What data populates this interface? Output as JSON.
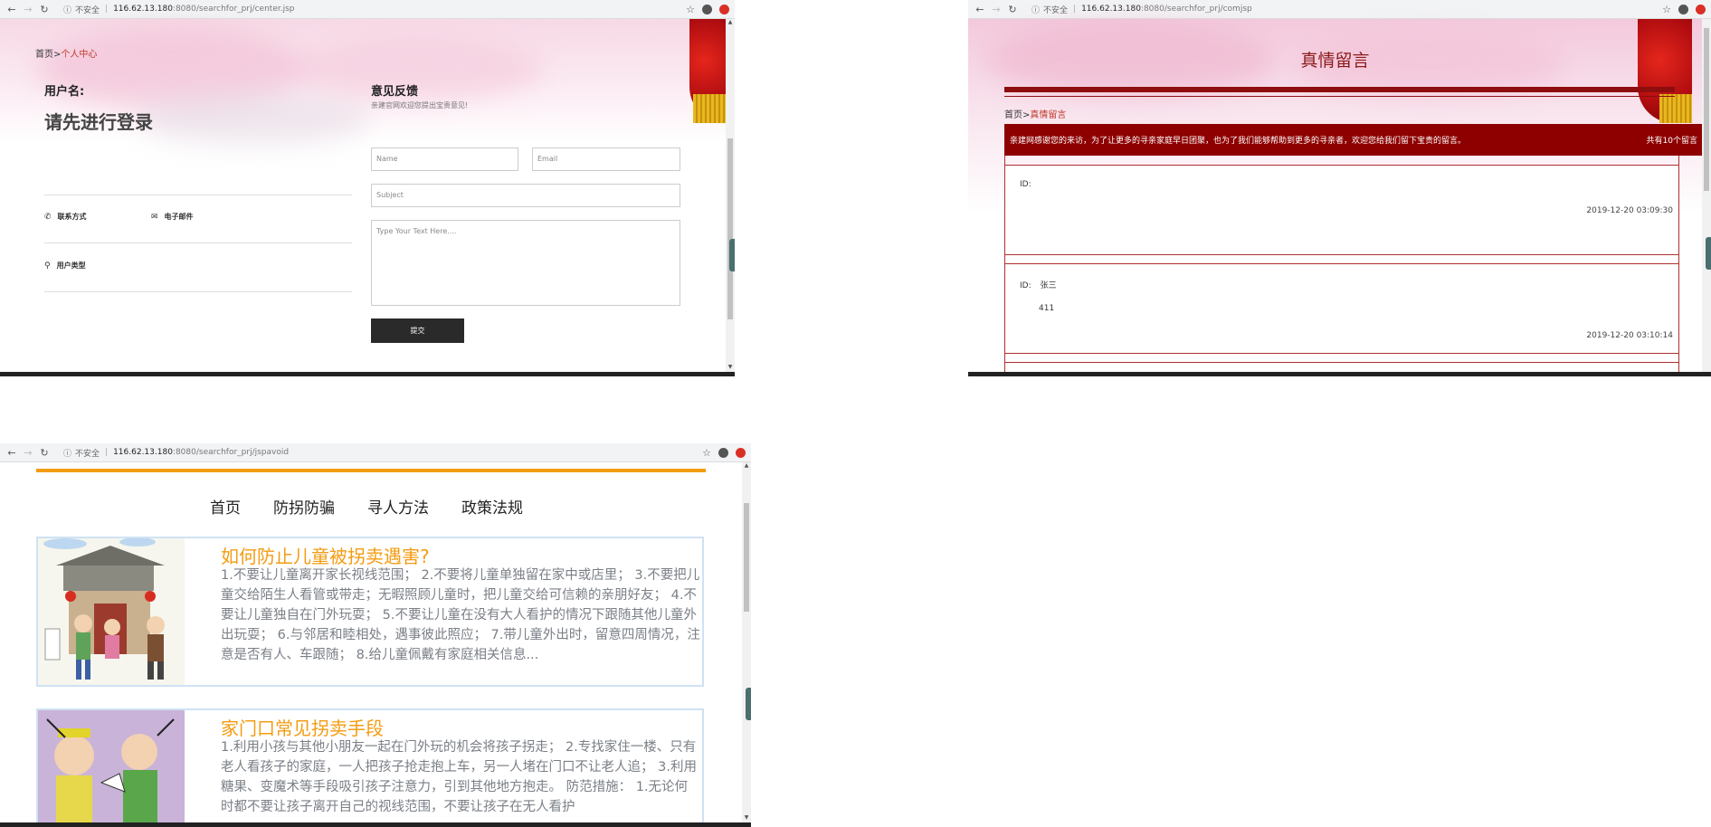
{
  "windows": {
    "center": {
      "url_insecure": "不安全",
      "url_host": "116.62.13.180",
      "url_path": ":8080/searchfor_prj/center.jsp",
      "breadcrumb_home": "首页",
      "breadcrumb_sep": ">",
      "breadcrumb_current": "个人中心",
      "username_label": "用户名:",
      "login_prompt": "请先进行登录",
      "contact_label": "联系方式",
      "email_label": "电子邮件",
      "usertype_label": "用户类型",
      "feedback_title": "意见反馈",
      "feedback_subtitle": "亲建官网欢迎您提出宝贵意见!",
      "name_placeholder": "Name",
      "email_placeholder": "Email",
      "subject_placeholder": "Subject",
      "text_placeholder": "Type Your Text Here....",
      "submit_label": "提交"
    },
    "messages": {
      "url_insecure": "不安全",
      "url_host": "116.62.13.180",
      "url_path": ":8080/searchfor_prj/comjsp",
      "page_title": "真情留言",
      "breadcrumb_home": "首页",
      "breadcrumb_sep": ">",
      "breadcrumb_current": "真情留言",
      "banner_text": "亲建网感谢您的来访，为了让更多的寻亲家庭早日团聚，也为了我们能够帮助到更多的寻亲者，欢迎您给我们留下宝贵的留言。",
      "banner_count": "共有10个留言",
      "items": [
        {
          "id_label": "ID:",
          "name": "",
          "text": "",
          "time": "2019-12-20 03:09:30"
        },
        {
          "id_label": "ID:",
          "name": "张三",
          "text": "411",
          "time": "2019-12-20 03:10:14"
        }
      ]
    },
    "articles": {
      "url_insecure": "不安全",
      "url_host": "116.62.13.180",
      "url_path": ":8080/searchfor_prj/jspavoid",
      "menu": [
        "首页",
        "防拐防骗",
        "寻人方法",
        "政策法规"
      ],
      "cards": [
        {
          "title": "如何防止儿童被拐卖遇害?",
          "body": "1.不要让儿童离开家长视线范围； 2.不要将儿童单独留在家中或店里； 3.不要把儿童交给陌生人看管或带走；无暇照顾儿童时，把儿童交给可信赖的亲朋好友； 4.不要让儿童独自在门外玩耍； 5.不要让儿童在没有大人看护的情况下跟随其他儿童外出玩耍； 6.与邻居和睦相处，遇事彼此照应； 7.带儿童外出时，留意四周情况，注意是否有人、车跟随； 8.给儿童佩戴有家庭相关信息..."
        },
        {
          "title": "家门口常见拐卖手段",
          "body": "1.利用小孩与其他小朋友一起在门外玩的机会将孩子拐走； 2.专找家住一楼、只有老人看孩子的家庭，一人把孩子抢走抱上车，另一人堵在门口不让老人追； 3.利用糖果、变魔术等手段吸引孩子注意力，引到其他地方抱走。 防范措施： 1.无论何时都不要让孩子离开自己的视线范围，不要让孩子在无人看护"
        }
      ]
    }
  },
  "colors": {
    "accent_red": "#8e0000",
    "accent_orange": "#f39c12",
    "link_red": "#c0392b"
  },
  "icons": [
    "back-icon",
    "forward-icon",
    "reload-icon",
    "info-icon",
    "star-icon",
    "account-icon",
    "extension-icon",
    "phone-icon",
    "mail-icon",
    "location-icon"
  ]
}
